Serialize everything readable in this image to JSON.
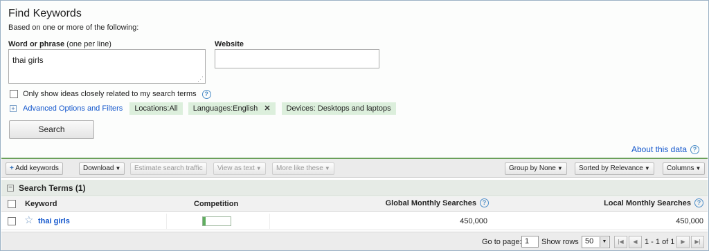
{
  "find": {
    "title": "Find Keywords",
    "subtitle": "Based on one or more of the following:",
    "word_label": "Word or phrase",
    "word_hint": "(one per line)",
    "word_value": "thai girls",
    "website_label": "Website",
    "website_value": "",
    "closely_related_label": "Only show ideas closely related to my search terms",
    "advanced_label": "Advanced Options and Filters",
    "chips": {
      "locations": "Locations:All",
      "languages": "Languages:English",
      "devices": "Devices: Desktops and laptops"
    },
    "search_button": "Search",
    "about_link": "About this data"
  },
  "toolbar": {
    "add_keywords": "Add keywords",
    "download": "Download",
    "estimate": "Estimate search traffic",
    "view_as_text": "View as text",
    "more_like_these": "More like these",
    "group_by": "Group by None",
    "sorted_by": "Sorted by Relevance",
    "columns": "Columns"
  },
  "results": {
    "section_title": "Search Terms (1)",
    "columns": {
      "keyword": "Keyword",
      "competition": "Competition",
      "global": "Global Monthly Searches",
      "local": "Local Monthly Searches"
    },
    "rows": [
      {
        "keyword": "thai girls",
        "competition": 0.1,
        "global": "450,000",
        "local": "450,000"
      }
    ]
  },
  "pagination": {
    "goto_label": "Go to page:",
    "goto_value": "1",
    "show_rows_label": "Show rows",
    "rows_value": "50",
    "range": "1 - 1 of 1"
  },
  "colors": {
    "accent_link": "#1155cc",
    "chip_bg": "#dcefdc",
    "toolbar_border": "#6aa05a",
    "competition_fill": "#5fae5f"
  },
  "icons": [
    "help-icon",
    "plus-box-icon",
    "close-icon",
    "minus-box-icon",
    "star-icon",
    "first-page-icon",
    "prev-page-icon",
    "next-page-icon",
    "last-page-icon"
  ]
}
